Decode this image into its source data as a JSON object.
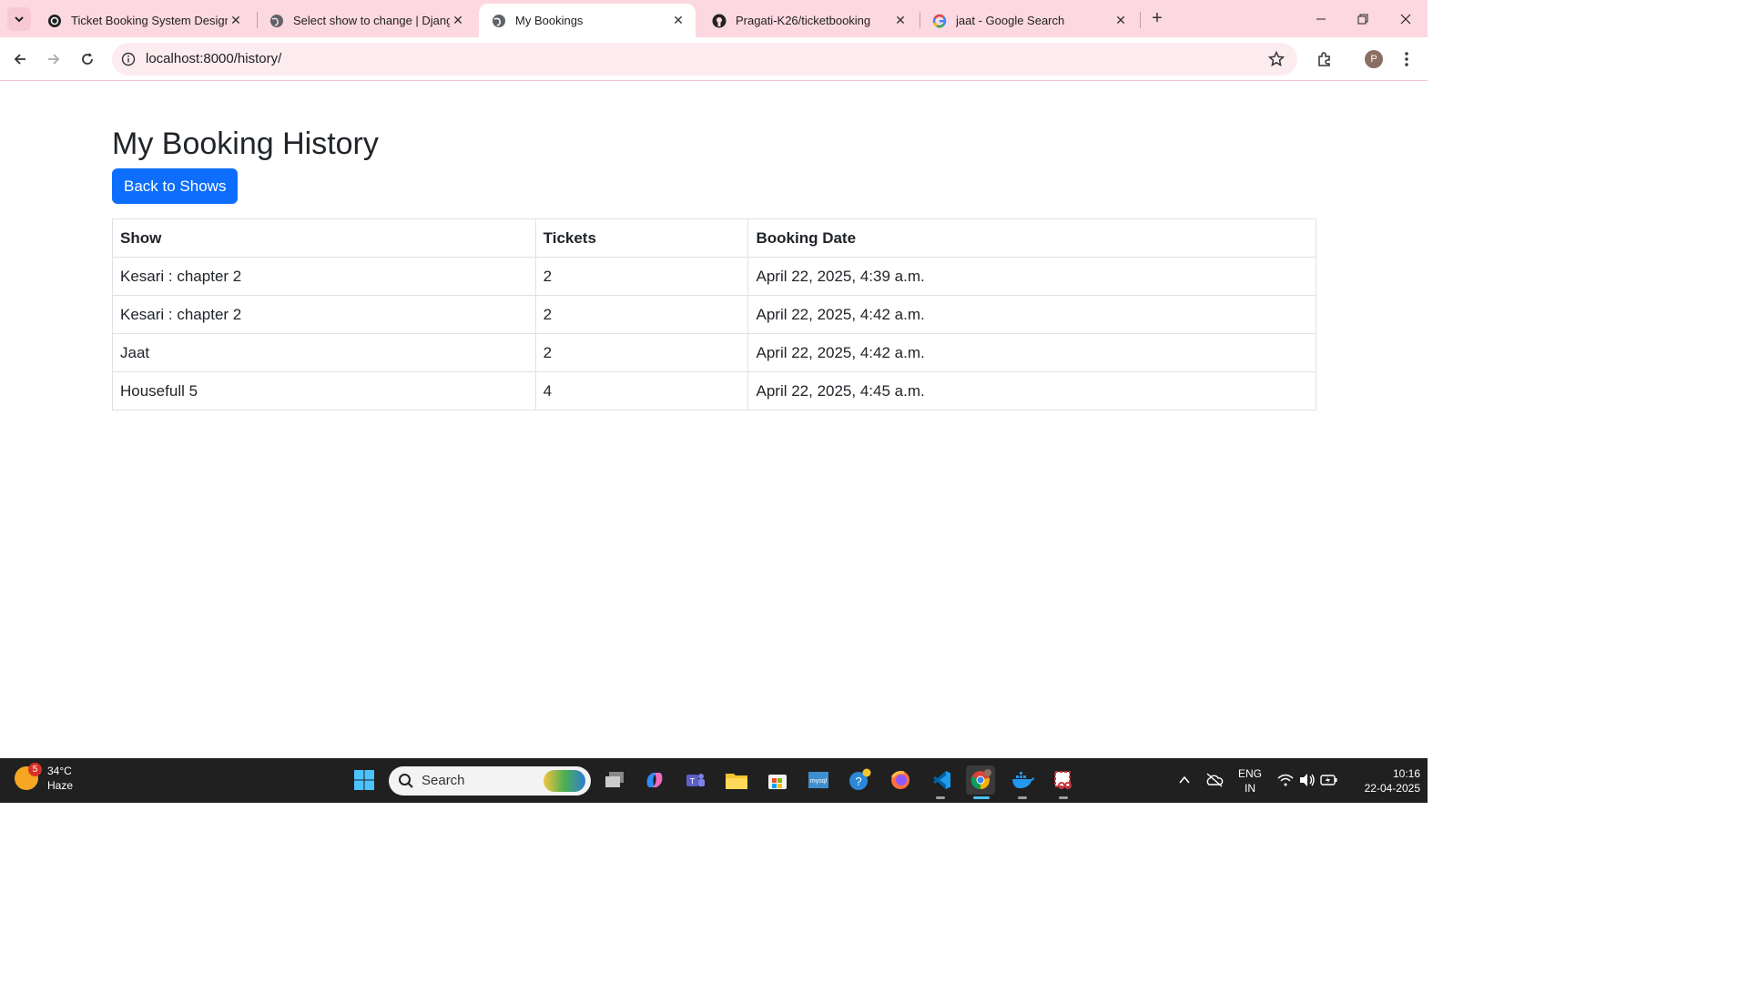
{
  "browser": {
    "tabs": [
      {
        "title": "Ticket Booking System Design",
        "icon": "openai-icon"
      },
      {
        "title": "Select show to change | Django",
        "icon": "globe-icon"
      },
      {
        "title": "My Bookings",
        "icon": "globe-icon",
        "active": true
      },
      {
        "title": "Pragati-K26/ticketbooking",
        "icon": "github-icon"
      },
      {
        "title": "jaat - Google Search",
        "icon": "google-icon"
      }
    ],
    "url": "localhost:8000/history/",
    "profile_initial": "P"
  },
  "page": {
    "title": "My Booking History",
    "back_button": "Back to Shows",
    "table": {
      "headers": [
        "Show",
        "Tickets",
        "Booking Date"
      ],
      "rows": [
        [
          "Kesari : chapter 2",
          "2",
          "April 22, 2025, 4:39 a.m."
        ],
        [
          "Kesari : chapter 2",
          "2",
          "April 22, 2025, 4:42 a.m."
        ],
        [
          "Jaat",
          "2",
          "April 22, 2025, 4:42 a.m."
        ],
        [
          "Housefull 5",
          "4",
          "April 22, 2025, 4:45 a.m."
        ]
      ]
    }
  },
  "taskbar": {
    "weather": {
      "temp": "34°C",
      "condition": "Haze",
      "badge": "5"
    },
    "search_label": "Search",
    "lang": {
      "line1": "ENG",
      "line2": "IN"
    },
    "clock": {
      "time": "10:16",
      "date": "22-04-2025"
    }
  },
  "colors": {
    "accent": "#0d6efd",
    "tabstrip": "#fcd8e1",
    "taskbar": "#202020"
  }
}
